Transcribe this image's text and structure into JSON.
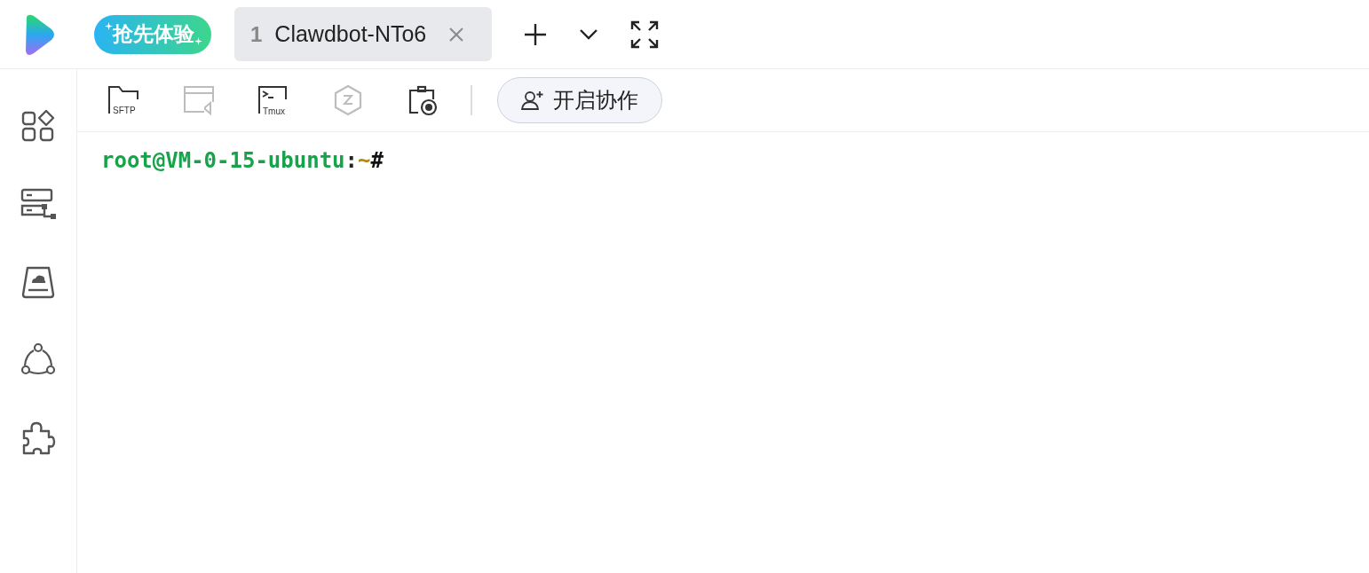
{
  "header": {
    "badge": "抢先体验",
    "tabs": [
      {
        "number": "1",
        "title": "Clawdbot-NTo6",
        "selected": true
      }
    ]
  },
  "sidebar": {
    "items": [
      {
        "kind": "apps"
      },
      {
        "kind": "servers"
      },
      {
        "kind": "drive"
      },
      {
        "kind": "network"
      },
      {
        "kind": "plugins"
      }
    ]
  },
  "toolbar": {
    "items": [
      {
        "kind": "sftp",
        "label": "SFTP",
        "disabled": false
      },
      {
        "kind": "editor",
        "disabled": true
      },
      {
        "kind": "tmux",
        "label": "Tmux",
        "disabled": false
      },
      {
        "kind": "hexagon",
        "disabled": true
      },
      {
        "kind": "record",
        "disabled": false
      }
    ],
    "collab_button": "开启协作"
  },
  "terminal": {
    "lines": [
      {
        "user": "root@VM-0-15-ubuntu",
        "separator": ":",
        "path": "~",
        "prompt": "#"
      }
    ]
  }
}
